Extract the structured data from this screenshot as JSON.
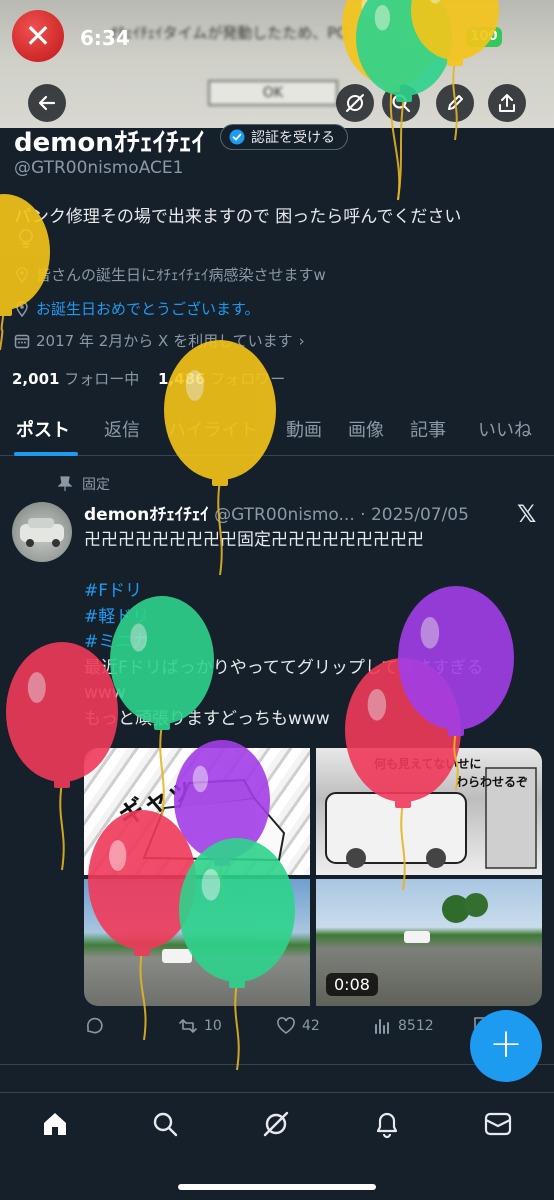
{
  "status_bar": {
    "time": "6:34",
    "battery": "100"
  },
  "banner": {
    "dialog_text": "ｵﾁｪｲﾁｪｲタイムが発動したため、PC",
    "ok_label": "OK"
  },
  "profile": {
    "name": "demonｵﾁｪｲﾁｪｲ",
    "verify_label": "認証を受ける",
    "handle": "@GTR00nismoACE1",
    "bio": "パンク修理その場で出来ますので 困ったら呼んでください",
    "location": "皆さんの誕生日にｵﾁｪｲﾁｪｲ病感染させますw",
    "website": "お誕生日おめでとうございます。",
    "joined": "2017 年 2月から X を利用しています",
    "following_count": "2,001",
    "following_label": "フォロー中",
    "followers_count": "1,486",
    "followers_label": "フォロワー"
  },
  "tabs": [
    "ポスト",
    "返信",
    "ハイライト",
    "動画",
    "画像",
    "記事",
    "いいね"
  ],
  "post": {
    "pinned_label": "固定",
    "author": "demonｵﾁｪｲﾁｪｲ",
    "handle": "@GTR00nismo...",
    "date": "· 2025/07/05",
    "lines": [
      "卍卍卍卍卍卍卍卍卍固定卍卍卍卍卍卍卍卍卍",
      "",
      "#Fドリ",
      "#軽ドリ",
      "#ミニカ",
      "最近Fドリばっかりやっててグリップして無さすぎる",
      "www",
      "もっと頑張りますどっちもwww"
    ],
    "tag_lines": [
      2,
      3,
      4
    ],
    "media": {
      "manga_text_1": "ギャッ",
      "manga_text_2": "何も見えてないせに",
      "manga_text_3": "わらわせるぞ",
      "video_duration": "0:08"
    },
    "stats": {
      "retweets": "10",
      "likes": "42",
      "views": "8512"
    }
  },
  "balloons": [
    {
      "color": "#f5c518"
    },
    {
      "color": "#2ed38c"
    },
    {
      "color": "#f5c518"
    },
    {
      "color": "#f5c518"
    },
    {
      "color": "#f5c518"
    },
    {
      "color": "#2ed38c"
    },
    {
      "color": "#f03a5a"
    },
    {
      "color": "#a23ee8"
    },
    {
      "color": "#f03a5a"
    },
    {
      "color": "#a23ee8"
    },
    {
      "color": "#f03a5a"
    },
    {
      "color": "#2ed38c"
    }
  ],
  "colors": {
    "accent": "#1d9bf0",
    "background": "#15202b"
  }
}
